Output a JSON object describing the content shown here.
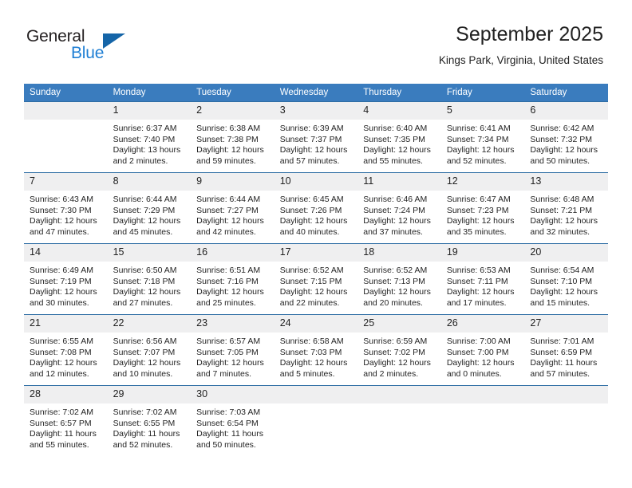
{
  "brand": {
    "name_top": "General",
    "name_bottom": "Blue",
    "logo_icon": "triangle-logo-icon",
    "color_dark": "#231f20",
    "color_blue": "#1f7fd4",
    "color_triangle": "#1565a8"
  },
  "header": {
    "title": "September 2025",
    "subtitle": "Kings Park, Virginia, United States"
  },
  "theme": {
    "header_row_bg": "#3a7cbe",
    "day_number_bg": "#efeff0",
    "row_divider": "#2e6da4",
    "text": "#232323"
  },
  "calendar": {
    "weekday_headers": [
      "Sunday",
      "Monday",
      "Tuesday",
      "Wednesday",
      "Thursday",
      "Friday",
      "Saturday"
    ],
    "weeks": [
      [
        {
          "day": "",
          "lines": []
        },
        {
          "day": "1",
          "lines": [
            "Sunrise: 6:37 AM",
            "Sunset: 7:40 PM",
            "Daylight: 13 hours",
            "and 2 minutes."
          ]
        },
        {
          "day": "2",
          "lines": [
            "Sunrise: 6:38 AM",
            "Sunset: 7:38 PM",
            "Daylight: 12 hours",
            "and 59 minutes."
          ]
        },
        {
          "day": "3",
          "lines": [
            "Sunrise: 6:39 AM",
            "Sunset: 7:37 PM",
            "Daylight: 12 hours",
            "and 57 minutes."
          ]
        },
        {
          "day": "4",
          "lines": [
            "Sunrise: 6:40 AM",
            "Sunset: 7:35 PM",
            "Daylight: 12 hours",
            "and 55 minutes."
          ]
        },
        {
          "day": "5",
          "lines": [
            "Sunrise: 6:41 AM",
            "Sunset: 7:34 PM",
            "Daylight: 12 hours",
            "and 52 minutes."
          ]
        },
        {
          "day": "6",
          "lines": [
            "Sunrise: 6:42 AM",
            "Sunset: 7:32 PM",
            "Daylight: 12 hours",
            "and 50 minutes."
          ]
        }
      ],
      [
        {
          "day": "7",
          "lines": [
            "Sunrise: 6:43 AM",
            "Sunset: 7:30 PM",
            "Daylight: 12 hours",
            "and 47 minutes."
          ]
        },
        {
          "day": "8",
          "lines": [
            "Sunrise: 6:44 AM",
            "Sunset: 7:29 PM",
            "Daylight: 12 hours",
            "and 45 minutes."
          ]
        },
        {
          "day": "9",
          "lines": [
            "Sunrise: 6:44 AM",
            "Sunset: 7:27 PM",
            "Daylight: 12 hours",
            "and 42 minutes."
          ]
        },
        {
          "day": "10",
          "lines": [
            "Sunrise: 6:45 AM",
            "Sunset: 7:26 PM",
            "Daylight: 12 hours",
            "and 40 minutes."
          ]
        },
        {
          "day": "11",
          "lines": [
            "Sunrise: 6:46 AM",
            "Sunset: 7:24 PM",
            "Daylight: 12 hours",
            "and 37 minutes."
          ]
        },
        {
          "day": "12",
          "lines": [
            "Sunrise: 6:47 AM",
            "Sunset: 7:23 PM",
            "Daylight: 12 hours",
            "and 35 minutes."
          ]
        },
        {
          "day": "13",
          "lines": [
            "Sunrise: 6:48 AM",
            "Sunset: 7:21 PM",
            "Daylight: 12 hours",
            "and 32 minutes."
          ]
        }
      ],
      [
        {
          "day": "14",
          "lines": [
            "Sunrise: 6:49 AM",
            "Sunset: 7:19 PM",
            "Daylight: 12 hours",
            "and 30 minutes."
          ]
        },
        {
          "day": "15",
          "lines": [
            "Sunrise: 6:50 AM",
            "Sunset: 7:18 PM",
            "Daylight: 12 hours",
            "and 27 minutes."
          ]
        },
        {
          "day": "16",
          "lines": [
            "Sunrise: 6:51 AM",
            "Sunset: 7:16 PM",
            "Daylight: 12 hours",
            "and 25 minutes."
          ]
        },
        {
          "day": "17",
          "lines": [
            "Sunrise: 6:52 AM",
            "Sunset: 7:15 PM",
            "Daylight: 12 hours",
            "and 22 minutes."
          ]
        },
        {
          "day": "18",
          "lines": [
            "Sunrise: 6:52 AM",
            "Sunset: 7:13 PM",
            "Daylight: 12 hours",
            "and 20 minutes."
          ]
        },
        {
          "day": "19",
          "lines": [
            "Sunrise: 6:53 AM",
            "Sunset: 7:11 PM",
            "Daylight: 12 hours",
            "and 17 minutes."
          ]
        },
        {
          "day": "20",
          "lines": [
            "Sunrise: 6:54 AM",
            "Sunset: 7:10 PM",
            "Daylight: 12 hours",
            "and 15 minutes."
          ]
        }
      ],
      [
        {
          "day": "21",
          "lines": [
            "Sunrise: 6:55 AM",
            "Sunset: 7:08 PM",
            "Daylight: 12 hours",
            "and 12 minutes."
          ]
        },
        {
          "day": "22",
          "lines": [
            "Sunrise: 6:56 AM",
            "Sunset: 7:07 PM",
            "Daylight: 12 hours",
            "and 10 minutes."
          ]
        },
        {
          "day": "23",
          "lines": [
            "Sunrise: 6:57 AM",
            "Sunset: 7:05 PM",
            "Daylight: 12 hours",
            "and 7 minutes."
          ]
        },
        {
          "day": "24",
          "lines": [
            "Sunrise: 6:58 AM",
            "Sunset: 7:03 PM",
            "Daylight: 12 hours",
            "and 5 minutes."
          ]
        },
        {
          "day": "25",
          "lines": [
            "Sunrise: 6:59 AM",
            "Sunset: 7:02 PM",
            "Daylight: 12 hours",
            "and 2 minutes."
          ]
        },
        {
          "day": "26",
          "lines": [
            "Sunrise: 7:00 AM",
            "Sunset: 7:00 PM",
            "Daylight: 12 hours",
            "and 0 minutes."
          ]
        },
        {
          "day": "27",
          "lines": [
            "Sunrise: 7:01 AM",
            "Sunset: 6:59 PM",
            "Daylight: 11 hours",
            "and 57 minutes."
          ]
        }
      ],
      [
        {
          "day": "28",
          "lines": [
            "Sunrise: 7:02 AM",
            "Sunset: 6:57 PM",
            "Daylight: 11 hours",
            "and 55 minutes."
          ]
        },
        {
          "day": "29",
          "lines": [
            "Sunrise: 7:02 AM",
            "Sunset: 6:55 PM",
            "Daylight: 11 hours",
            "and 52 minutes."
          ]
        },
        {
          "day": "30",
          "lines": [
            "Sunrise: 7:03 AM",
            "Sunset: 6:54 PM",
            "Daylight: 11 hours",
            "and 50 minutes."
          ]
        },
        {
          "day": "",
          "lines": []
        },
        {
          "day": "",
          "lines": []
        },
        {
          "day": "",
          "lines": []
        },
        {
          "day": "",
          "lines": []
        }
      ]
    ]
  }
}
